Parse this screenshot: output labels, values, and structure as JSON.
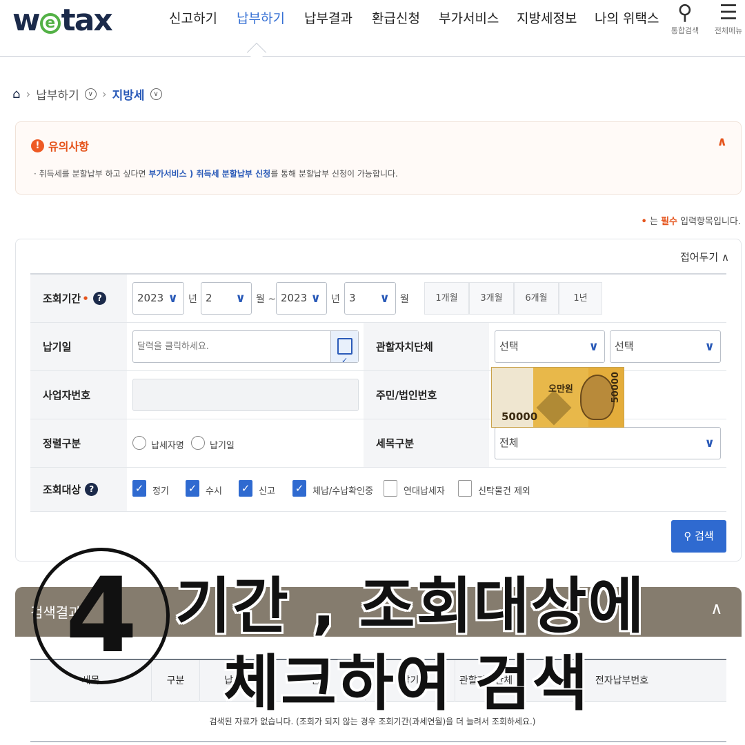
{
  "header": {
    "logo_pre": "w",
    "logo_e": "e",
    "logo_post": "tax",
    "nav": [
      "신고하기",
      "납부하기",
      "납부결과",
      "환급신청",
      "부가서비스",
      "지방세정보",
      "나의 위택스"
    ],
    "active_nav": "납부하기",
    "search_label": "통합검색",
    "menu_label": "전체메뉴"
  },
  "breadcrumb": {
    "level1": "납부하기",
    "level2": "지방세"
  },
  "notice": {
    "title": "유의사항",
    "text_before": "· 취득세를 분할납부 하고 싶다면 ",
    "link": "부가서비스 ) 취득세 분할납부 신청",
    "text_after": "를 통해 분할납부 신청이 가능합니다."
  },
  "required_note": {
    "dot": "•",
    "prefix": " 는 ",
    "keyword": "필수",
    "suffix": " 입력항목입니다."
  },
  "panel": {
    "fold_label": "접어두기 ∧",
    "period": {
      "label": "조회기간",
      "start_year": "2023",
      "start_month": "2",
      "end_year": "2023",
      "end_month": "3",
      "unit_year": "년",
      "unit_month": "월",
      "unit_month_tilde": "월 ~",
      "buttons": [
        "1개월",
        "3개월",
        "6개월",
        "1년"
      ]
    },
    "pay_date": {
      "label": "납기일",
      "placeholder": "달력을 클릭하세요."
    },
    "jurisdiction": {
      "label": "관할자치단체",
      "select1": "선택",
      "select2": "선택"
    },
    "business_no": {
      "label": "사업자번호"
    },
    "resident_no": {
      "label": "주민/법인번호"
    },
    "sort": {
      "label": "정렬구분",
      "options": [
        "납세자명",
        "납기일"
      ]
    },
    "tax_type": {
      "label": "세목구분",
      "value": "전체"
    },
    "target": {
      "label": "조회대상",
      "options": [
        {
          "label": "정기",
          "checked": true
        },
        {
          "label": "수시",
          "checked": true
        },
        {
          "label": "신고",
          "checked": true
        },
        {
          "label": "체납/수납확인중",
          "checked": true
        },
        {
          "label": "연대납세자",
          "checked": false
        },
        {
          "label": "신탁물건 제외",
          "checked": false
        }
      ]
    },
    "search_button": "검색"
  },
  "banknote": {
    "top_text": "오만원",
    "value": "50000"
  },
  "results": {
    "title": "검색결과",
    "columns": [
      "세목",
      "구분",
      "납세자",
      "금액",
      "납기",
      "관할자치단체",
      "전자납부번호"
    ],
    "empty_message": "검색된 자료가 없습니다. (조회가 되지 않는 경우 조회기간(과세연월)을 더 늘려서 조회하세요.)"
  },
  "caption": {
    "step": "4",
    "line1": "기간 , 조회대상에",
    "line2": "체크하여 검색"
  }
}
